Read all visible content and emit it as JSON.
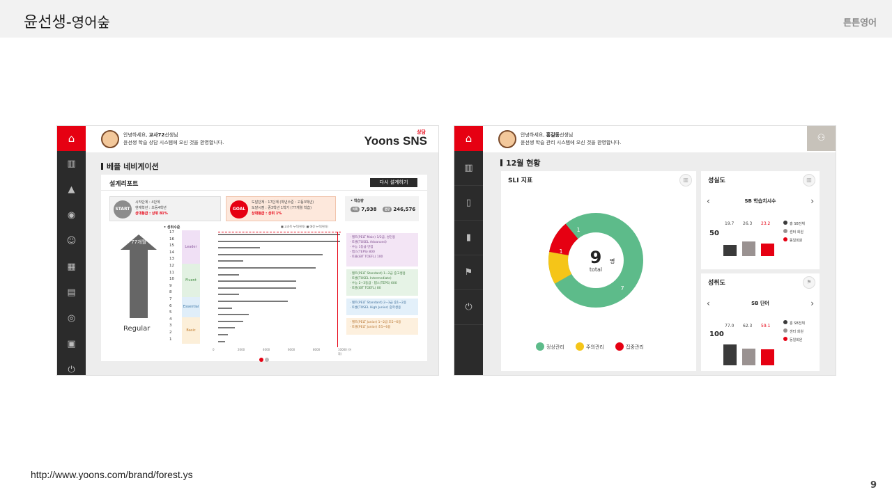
{
  "header": {
    "title_main": "윤선생",
    "title_sep": "-",
    "title_sub": "영어숲",
    "brand": "튼튼영어"
  },
  "footer": {
    "url": "http://www.yoons.com/brand/forest.ys",
    "page_number": "9"
  },
  "left_shot": {
    "greeting_line1": "안녕하세요, ",
    "greeting_name": "교사72",
    "greeting_line1_tail": "선생님",
    "greeting_line2": "윤선생 학습 상담 시스템에 오신 것을 환영합니다.",
    "logo_badge": "상담",
    "logo": "Yoons SNS",
    "section_title": "베플 네비게이션",
    "report_title": "설계리포트",
    "report_button": "다시 설계하기",
    "start": {
      "badge": "START",
      "line1": "시작단계 : 4단계",
      "line2": "현재학년 : 초등4학년",
      "line3": "상대등급 : 상위 81%"
    },
    "goal": {
      "badge": "GOAL",
      "line1": "도달단계 : 17단계 (학년수준 : 고등3학년)",
      "line2": "도달시점 : 중3학년 1학기 (77개월 학습)",
      "line3": "상대등급 : 상위 1%"
    },
    "study": {
      "label": "• 학습량",
      "pill1": "어휘",
      "value1": "7,938",
      "pill2": "문장",
      "value2": "246,576"
    },
    "arrow_label": "77개월",
    "regular_label": "Regular",
    "levels_label": "• 성취수준",
    "legend": "■ 교과목 누적(편차)  ■ 예정 누적(편차)",
    "bands": [
      "Leader",
      "Fluent",
      "Essential",
      "Basic"
    ],
    "level_numbers": [
      "17",
      "16",
      "15",
      "14",
      "13",
      "12",
      "11",
      "10",
      "9",
      "8",
      "7",
      "6",
      "5",
      "4",
      "3",
      "2",
      "1"
    ],
    "axis_ticks": [
      "0",
      "2000",
      "4000",
      "6000",
      "8000",
      "10000 (어휘)"
    ],
    "cards": [
      "· 텔트(PELT Main) 1/2급, 성인용\n· 토셀(TOSEL Advanced)\n· 수능 1등급 만점\n· 텝스(TEPS) 800\n· 토플(iBT TOEFL) 100",
      "· 텔트(PELT Standard) 1~2급 중고생용\n· 토셀(TOSEL Intermediate)\n· 수능 2~3등급 · 텝스(TEPS) 600\n· 토플(iBT TOEFL) 80",
      "· 텔트(PELT Standard) 2~3급 중1~2용\n· 토셀(TOSEL High Junior) 중학생용",
      "· 텔트(PELT Junior) 1~2급 초5~6용\n· 토셀(PELT Junior) 초5~6용"
    ]
  },
  "right_shot": {
    "greeting_line1": "안녕하세요, ",
    "greeting_name": "홍길동",
    "greeting_line1_tail": "선생님",
    "greeting_line2": "윤선생 학습 관리 시스템에 오신 것을 환영합니다.",
    "section_title": "12월 현황",
    "sli_title": "SLI 지표",
    "donut_center": "9",
    "donut_unit": "명",
    "donut_sub": "total",
    "donut_labels": [
      "7",
      "1",
      "1"
    ],
    "legend": [
      "정상관리",
      "주의관리",
      "집중관리"
    ],
    "colors": {
      "green": "#5dbb8a",
      "yellow": "#f5c518",
      "red": "#e60012"
    },
    "sincerity": {
      "title": "성실도",
      "nav": "SB 학습치시수",
      "big_number": "50",
      "values": [
        "19.7",
        "26.3",
        "23.2"
      ],
      "legend": [
        "홍 SB전체",
        "센터 회원",
        "동일회원"
      ]
    },
    "achievement": {
      "title": "성취도",
      "nav": "SB 단어",
      "big_number": "100",
      "values": [
        "77.0",
        "62.3",
        "59.1"
      ],
      "legend": [
        "홍 SB전체",
        "센터 회원",
        "동일회원"
      ]
    }
  }
}
